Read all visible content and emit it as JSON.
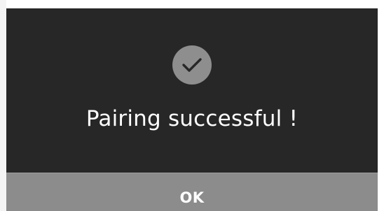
{
  "dialog": {
    "icon": "checkmark-icon",
    "message": "Pairing successful !",
    "ok_label": "OK"
  },
  "colors": {
    "dialog_background": "#272727",
    "badge_background": "#8e8e8e",
    "button_background": "#8c8c8c",
    "text": "#ffffff"
  }
}
